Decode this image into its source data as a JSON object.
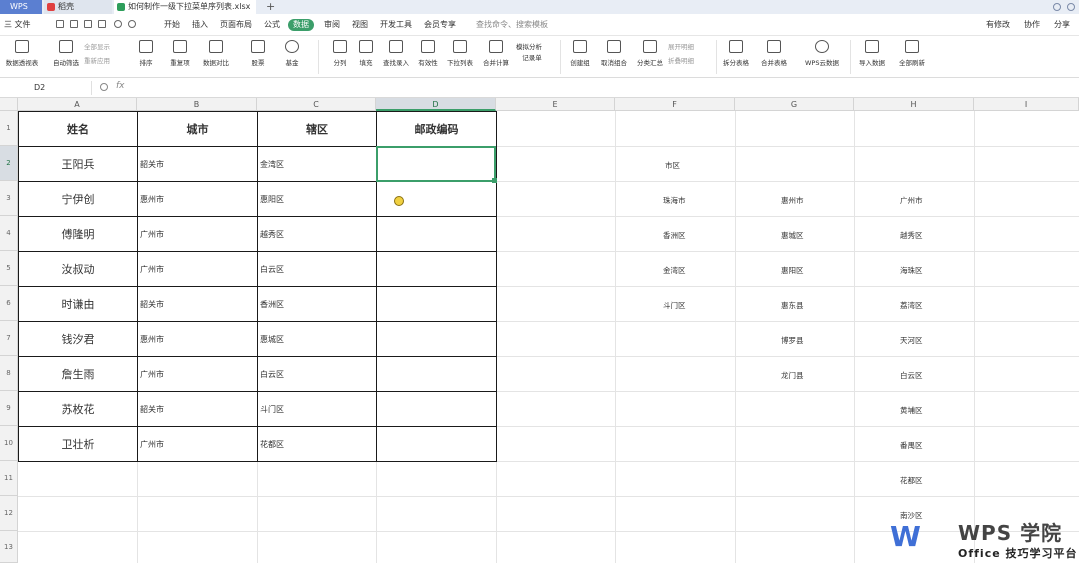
{
  "tabs": {
    "wps": "WPS",
    "daoke": "稻壳",
    "doc": "如何制作一级下拉菜单序列表.xlsx",
    "new_tab": "+"
  },
  "menu": {
    "file": "三 文件",
    "items": [
      "开始",
      "插入",
      "页面布局",
      "公式",
      "数据",
      "审阅",
      "视图",
      "开发工具",
      "会员专享"
    ],
    "active": "数据",
    "search": "查找命令、搜索模板",
    "right": [
      "有修改",
      "协作",
      "分享"
    ]
  },
  "ribbon": {
    "buttons": [
      "数据透视表",
      "自动筛选",
      "排序",
      "重复项",
      "数据对比",
      "股票",
      "基金",
      "分列",
      "填充",
      "查找录入",
      "有效性",
      "下拉列表",
      "合并计算",
      "记录单",
      "创建组",
      "取消组合",
      "分类汇总",
      "拆分表格",
      "合并表格",
      "WPS云数据",
      "导入数据",
      "全部刷新"
    ],
    "small": [
      "全部显示",
      "重新应用",
      "模拟分析",
      "展开明细",
      "折叠明细"
    ]
  },
  "formula_bar": {
    "cell_ref": "D2",
    "fx": "fx",
    "value": ""
  },
  "grid": {
    "columns": [
      "A",
      "B",
      "C",
      "D",
      "E",
      "F",
      "G",
      "H",
      "I"
    ],
    "selected_column": "D",
    "rows": [
      "1",
      "2",
      "3",
      "4",
      "5",
      "6",
      "7",
      "8",
      "9",
      "10",
      "11",
      "12",
      "13"
    ],
    "selected_row": "2"
  },
  "table": {
    "headers": [
      "姓名",
      "城市",
      "辖区",
      "邮政编码"
    ],
    "rows": [
      {
        "name": "王阳兵",
        "city": "韶关市",
        "district": "金湾区"
      },
      {
        "name": "宁伊创",
        "city": "惠州市",
        "district": "惠阳区"
      },
      {
        "name": "傅隆明",
        "city": "广州市",
        "district": "越秀区"
      },
      {
        "name": "汝叔动",
        "city": "广州市",
        "district": "白云区"
      },
      {
        "name": "时谦由",
        "city": "韶关市",
        "district": "香洲区"
      },
      {
        "name": "钱汐君",
        "city": "惠州市",
        "district": "惠城区"
      },
      {
        "name": "詹生雨",
        "city": "广州市",
        "district": "白云区"
      },
      {
        "name": "苏枚花",
        "city": "韶关市",
        "district": "斗门区"
      },
      {
        "name": "卫壮析",
        "city": "广州市",
        "district": "花都区"
      }
    ]
  },
  "side_lists": {
    "f": [
      "市区",
      "珠海市",
      "香洲区",
      "金湾区",
      "斗门区"
    ],
    "g": [
      "惠州市",
      "惠城区",
      "惠阳区",
      "惠东县",
      "博罗县",
      "龙门县"
    ],
    "h": [
      "广州市",
      "越秀区",
      "海珠区",
      "荔湾区",
      "天河区",
      "白云区",
      "黄埔区",
      "番禺区",
      "花都区",
      "南沙区"
    ]
  },
  "watermark": {
    "logo": "W",
    "title": "WPS 学院",
    "subtitle": "Office 技巧学习平台"
  },
  "colors": {
    "accent": "#3b9e6a",
    "wps_blue": "#3f6fd6"
  }
}
